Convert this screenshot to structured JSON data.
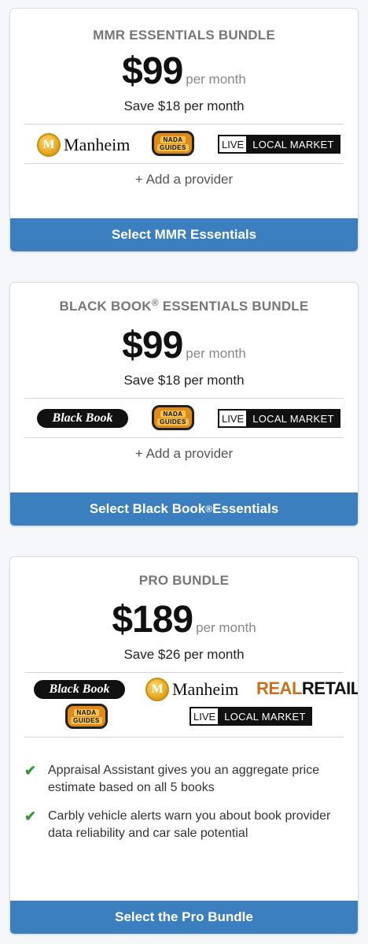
{
  "bundles": [
    {
      "title": "MMR ESSENTIALS BUNDLE",
      "price": "$99",
      "per": "per month",
      "save": "Save $18 per month",
      "add_provider": "+ Add a provider",
      "cta": "Select MMR Essentials"
    },
    {
      "title_pre": "BLACK BOOK",
      "title_sup": "®",
      "title_post": " ESSENTIALS BUNDLE",
      "price": "$99",
      "per": "per month",
      "save": "Save $18 per month",
      "add_provider": "+ Add a provider",
      "cta_pre": "Select Black Book",
      "cta_sup": "®",
      "cta_post": " Essentials"
    },
    {
      "title": "PRO BUNDLE",
      "price": "$189",
      "per": "per month",
      "save": "Save $26 per month",
      "features": [
        "Appraisal Assistant gives you an aggregate price estimate based on all 5 books",
        "Carbly vehicle alerts warn you about book provider data reliability and car sale potential"
      ],
      "cta": "Select the Pro Bundle"
    }
  ],
  "logos": {
    "manheim": "Manheim",
    "manheim_badge": "M",
    "nada_top": "NADA",
    "nada_bottom": "GUIDES",
    "live": "LIVE",
    "local_market": "LOCAL MARKET",
    "black_book": "Black Book",
    "real": "REAL",
    "retail": "RETAIL"
  },
  "colors": {
    "cta_bg": "#3b7fbf",
    "check": "#3a9a3a",
    "real_orange": "#c9701c"
  },
  "icons": {
    "check": "✔"
  }
}
